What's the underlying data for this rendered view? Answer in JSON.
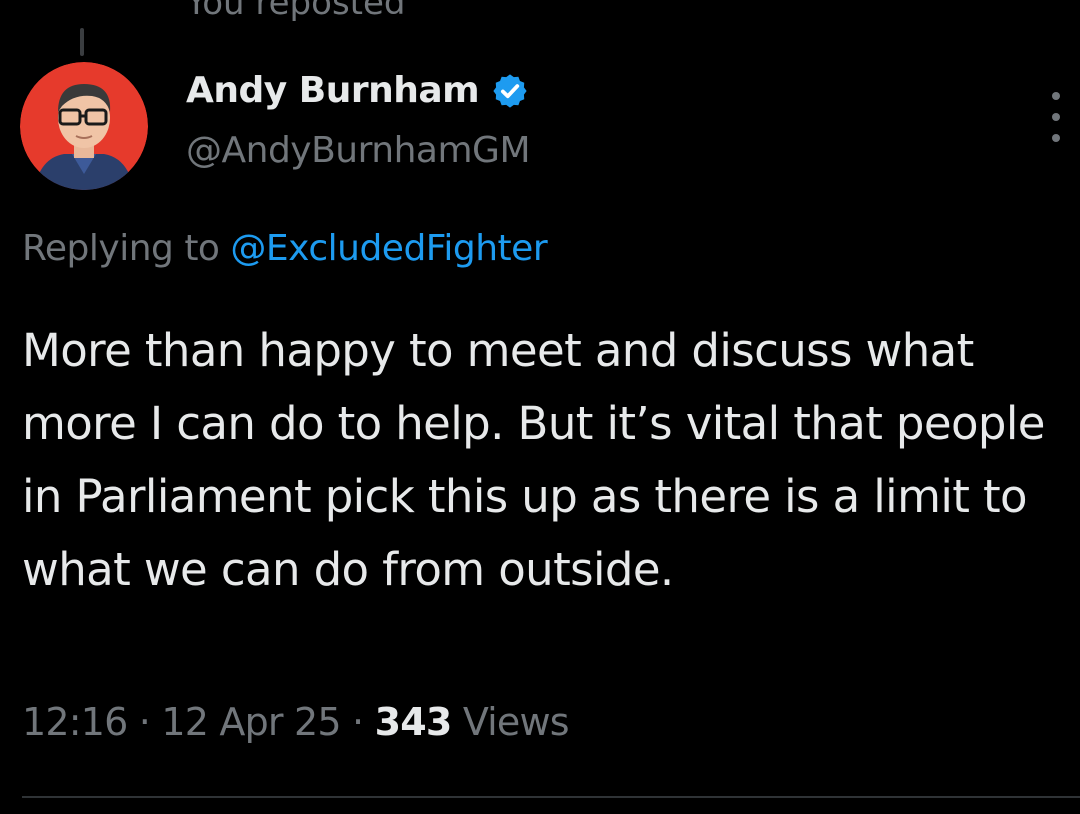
{
  "header": {
    "repost_label": "You reposted"
  },
  "author": {
    "display_name": "Andy Burnham",
    "handle": "@AndyBurnhamGM",
    "verified": true,
    "avatar_icon": "avatar-cartoon-man-glasses",
    "avatar_bg_color": "#e63a2c"
  },
  "reply": {
    "prefix": "Replying to",
    "to_handle": "@ExcludedFighter"
  },
  "tweet": {
    "text": "More than happy to meet and discuss what more I can do to help. But it’s vital that people in Parliament pick this up as there is a limit to what we can do from outside."
  },
  "meta": {
    "time": "12:16",
    "separator": "·",
    "date": "12 Apr 25",
    "views_count": "343",
    "views_label": "Views"
  },
  "colors": {
    "background": "#000000",
    "text_primary": "#e7e9ea",
    "text_secondary": "#71767b",
    "link": "#1d9bf0",
    "verified_badge": "#1d9bf0"
  }
}
